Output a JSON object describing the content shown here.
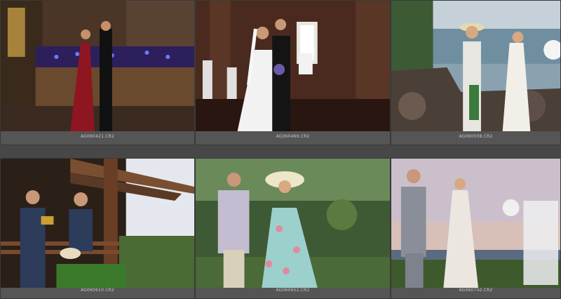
{
  "grid": {
    "background": "#4a4a4a",
    "cells": [
      {
        "filename": "AG060421.CR2",
        "scene": "evening-terrace-red-gown"
      },
      {
        "filename": "AG060469.CR2",
        "scene": "chapel-interior-bouquet"
      },
      {
        "filename": "AG060508.CR2",
        "scene": "seaside-rocks-hat"
      },
      {
        "filename": "AG060610.CR2",
        "scene": "pergola-balcony-camera"
      },
      {
        "filename": "AG060652.CR2",
        "scene": "garden-floral-dress"
      },
      {
        "filename": "AG060742.CR2",
        "scene": "dusk-field-walk"
      }
    ]
  },
  "colors": {
    "frame": "#555555",
    "caption_text": "#c8c8c8",
    "top_bar": "#5d5d5d"
  }
}
